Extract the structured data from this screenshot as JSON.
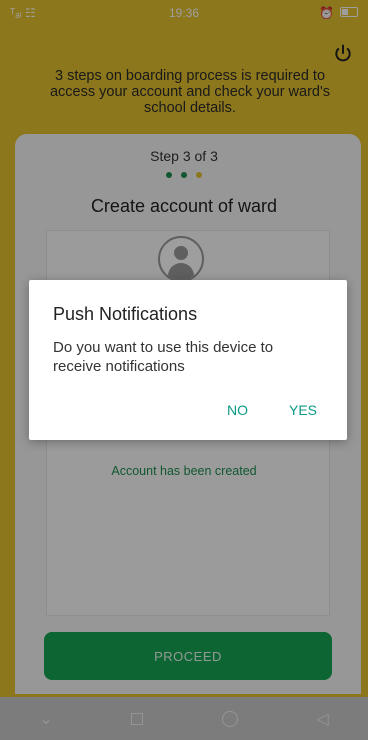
{
  "status_bar": {
    "signal": "ᵀₐₗ ☷",
    "time": "19:36"
  },
  "header": {
    "instructions": "3 steps on boarding process is required to access your account and check your ward's school details."
  },
  "card": {
    "step_label": "Step 3 of 3",
    "step_dots": [
      "#1c8f4f",
      "#1c8f4f",
      "#e3c02e"
    ],
    "title": "Create account of ward",
    "success_message": "Account has been created"
  },
  "proceed_button": {
    "label": "PROCEED"
  },
  "dialog": {
    "title": "Push Notifications",
    "message": "Do you want to use this device to receive notifications",
    "no_label": "NO",
    "yes_label": "YES"
  },
  "icons": {
    "power": "power-icon",
    "avatar": "user-avatar-icon",
    "nav": [
      "chevron-down-icon",
      "square-icon",
      "circle-icon",
      "back-triangle-icon"
    ]
  },
  "colors": {
    "background": "#e3c02e",
    "accent": "#15a355",
    "dialog_buttons": "#0a9a86"
  }
}
